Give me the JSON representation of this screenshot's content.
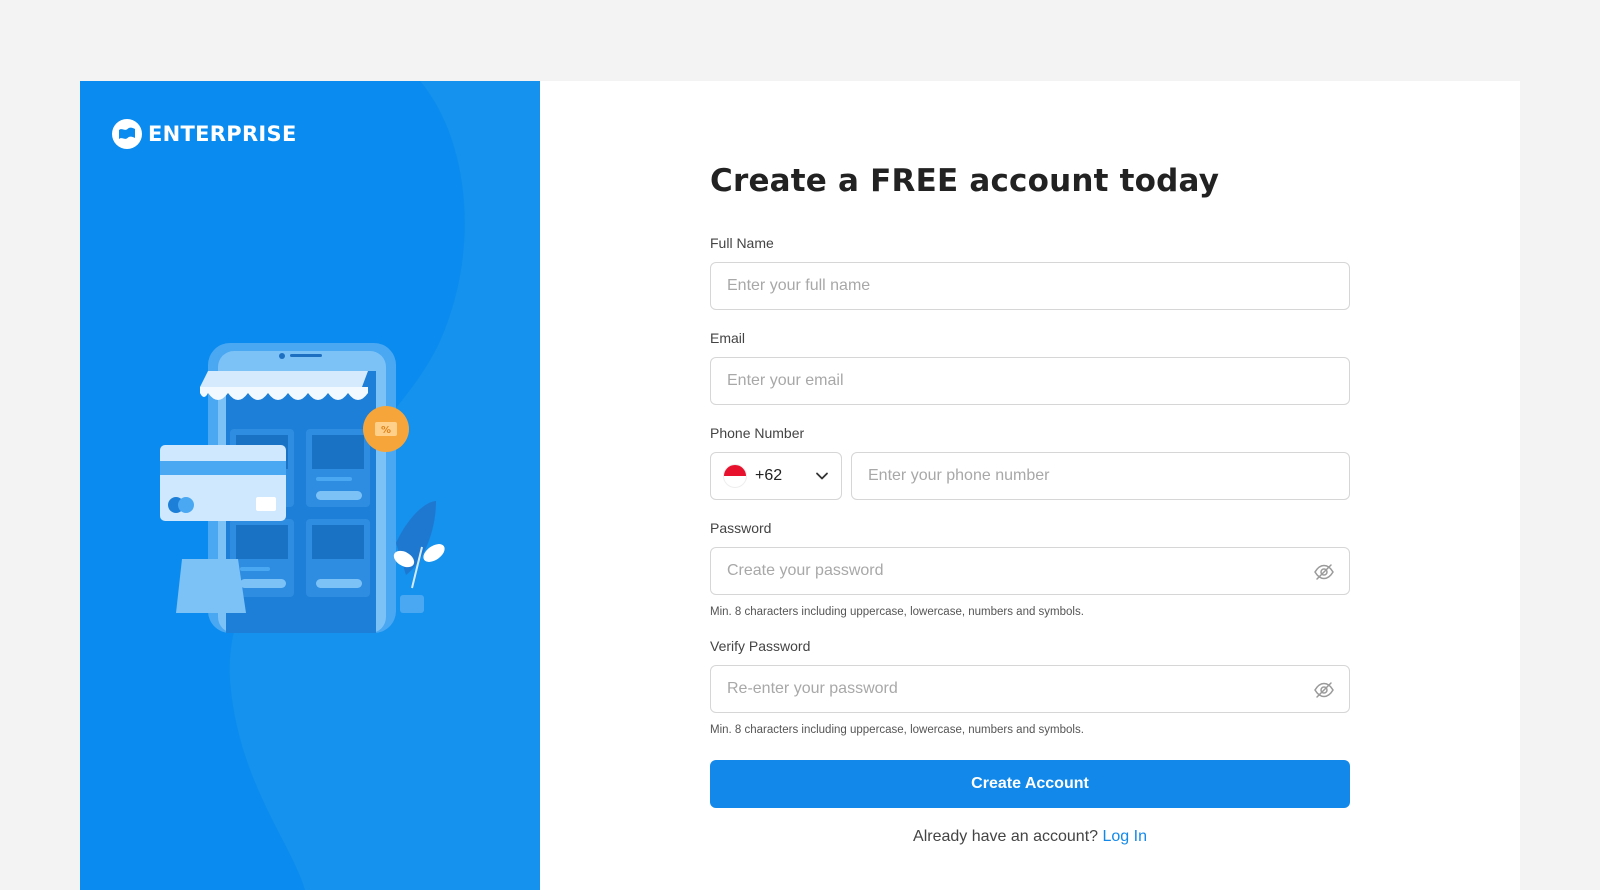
{
  "brand": {
    "name": "ENTERPRISE",
    "logo_icon": "enterprise-logo-icon"
  },
  "colors": {
    "panel_blue": "#0a8bef",
    "button_blue": "#1289ea",
    "link_blue": "#1289ea",
    "accent_orange": "#f6a53a"
  },
  "form": {
    "title": "Create a FREE account today",
    "full_name": {
      "label": "Full Name",
      "placeholder": "Enter your full name",
      "value": ""
    },
    "email": {
      "label": "Email",
      "placeholder": "Enter your email",
      "value": ""
    },
    "phone": {
      "label": "Phone Number",
      "country_code": "+62",
      "flag_icon": "indonesia-flag-icon",
      "placeholder": "Enter your phone number",
      "value": ""
    },
    "password": {
      "label": "Password",
      "placeholder": "Create your password",
      "hint": "Min. 8 characters including uppercase, lowercase, numbers and symbols.",
      "toggle_icon": "eye-off-icon"
    },
    "verify_password": {
      "label": "Verify Password",
      "placeholder": "Re-enter your password",
      "hint": "Min. 8 characters including uppercase, lowercase, numbers and symbols.",
      "toggle_icon": "eye-off-icon"
    },
    "submit_label": "Create Account",
    "login_prompt": "Already have an account?",
    "login_link": "Log In"
  }
}
